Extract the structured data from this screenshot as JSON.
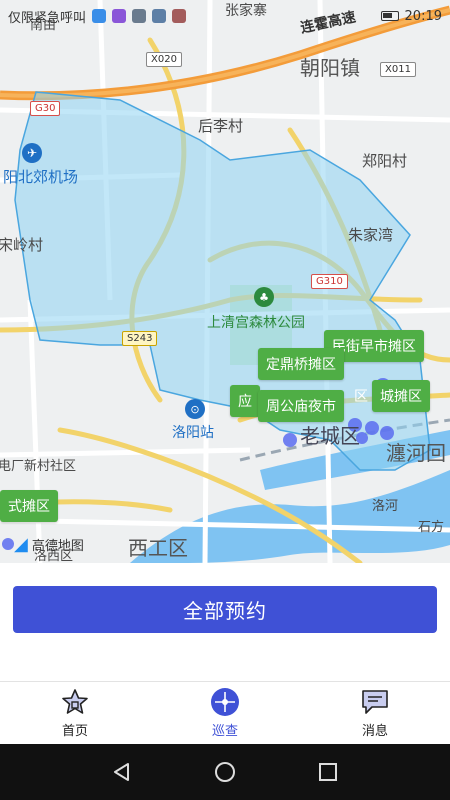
{
  "status_bar": {
    "left_text": "仅限紧急呼叫",
    "time": "20:19"
  },
  "map": {
    "labels": {
      "luoyang_airport": "阳北郊机场",
      "chaoyang_town": "朝阳镇",
      "housi_village": "后李村",
      "zhengyang_village": "郑阳村",
      "zhujia_wan": "朱家湾",
      "song_village": "宋岭村",
      "shangqing_park": "上清宫森林公园",
      "luoyang_station": "洛阳站",
      "xigong_district": "西工区",
      "laocheng_district": "老城区",
      "chanhe": "瀍河回",
      "luohe": "洛河",
      "shifang": "石方",
      "dianchang_community": "电厂新村社区",
      "zhangjia": "张家寨",
      "nanwei": "南由",
      "luoxi": "洛西区"
    },
    "road_shields": {
      "g30": "G30",
      "x020": "X020",
      "x011": "X011",
      "g310": "G310",
      "s243": "S243"
    },
    "expressway": "连霍高速",
    "stall_tags": {
      "minjie": "民街早市摊区",
      "dingding": "定鼎桥摊区",
      "zhougong": "周公庙夜市",
      "chengtan": "城摊区",
      "ying": "应",
      "qu": "区",
      "shi": "式摊区"
    },
    "amap_logo": "高德地图"
  },
  "panel": {
    "reserve_label": "全部预约"
  },
  "tabs": [
    {
      "label": "首页",
      "icon": "home-star-icon",
      "active": false
    },
    {
      "label": "巡查",
      "icon": "patrol-compass-icon",
      "active": true
    },
    {
      "label": "消息",
      "icon": "message-icon",
      "active": false
    }
  ],
  "colors": {
    "accent": "#3f51d6",
    "stall_tag": "#4fae45",
    "region_fill": "#8fd3f2"
  }
}
